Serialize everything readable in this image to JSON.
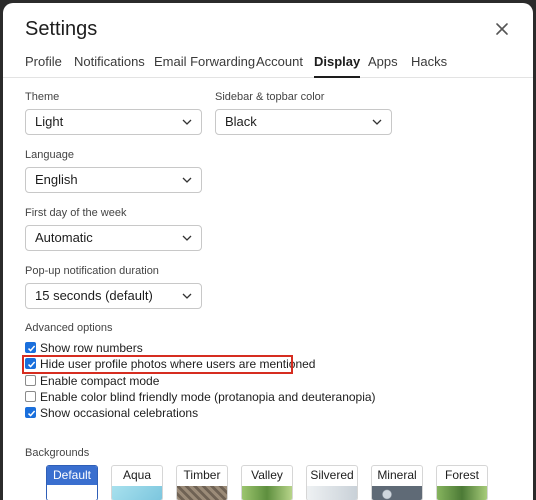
{
  "dialog": {
    "title": "Settings"
  },
  "tabs": [
    {
      "label": "Profile"
    },
    {
      "label": "Notifications"
    },
    {
      "label": "Email Forwarding"
    },
    {
      "label": "Account"
    },
    {
      "label": "Display",
      "active": true
    },
    {
      "label": "Apps"
    },
    {
      "label": "Hacks"
    }
  ],
  "display": {
    "theme": {
      "label": "Theme",
      "value": "Light"
    },
    "sidebar_color": {
      "label": "Sidebar & topbar color",
      "value": "Black"
    },
    "language": {
      "label": "Language",
      "value": "English"
    },
    "first_day": {
      "label": "First day of the week",
      "value": "Automatic"
    },
    "popup_duration": {
      "label": "Pop-up notification duration",
      "value": "15 seconds (default)"
    }
  },
  "advanced": {
    "label": "Advanced options",
    "options": [
      {
        "label": "Show row numbers",
        "checked": true
      },
      {
        "label": "Hide user profile photos where users are mentioned",
        "checked": true,
        "highlighted": true
      },
      {
        "label": "Enable compact mode",
        "checked": false
      },
      {
        "label": "Enable color blind friendly mode (protanopia and deuteranopia)",
        "checked": false
      },
      {
        "label": "Show occasional celebrations",
        "checked": true
      }
    ]
  },
  "backgrounds": {
    "label": "Backgrounds",
    "items": [
      {
        "name": "Default",
        "selected": true,
        "color": "#ffffff"
      },
      {
        "name": "Aqua",
        "color": "#8fd3e8"
      },
      {
        "name": "Timber",
        "color": "#8a7a6a"
      },
      {
        "name": "Valley",
        "color": "#7fae5a"
      },
      {
        "name": "Silvered",
        "color": "#d7dde2"
      },
      {
        "name": "Mineral",
        "color": "#6f7a86"
      },
      {
        "name": "Forest",
        "color": "#5f8f4a"
      }
    ]
  },
  "colors": {
    "accent": "#1a6fdc",
    "highlight": "#d62d20"
  }
}
